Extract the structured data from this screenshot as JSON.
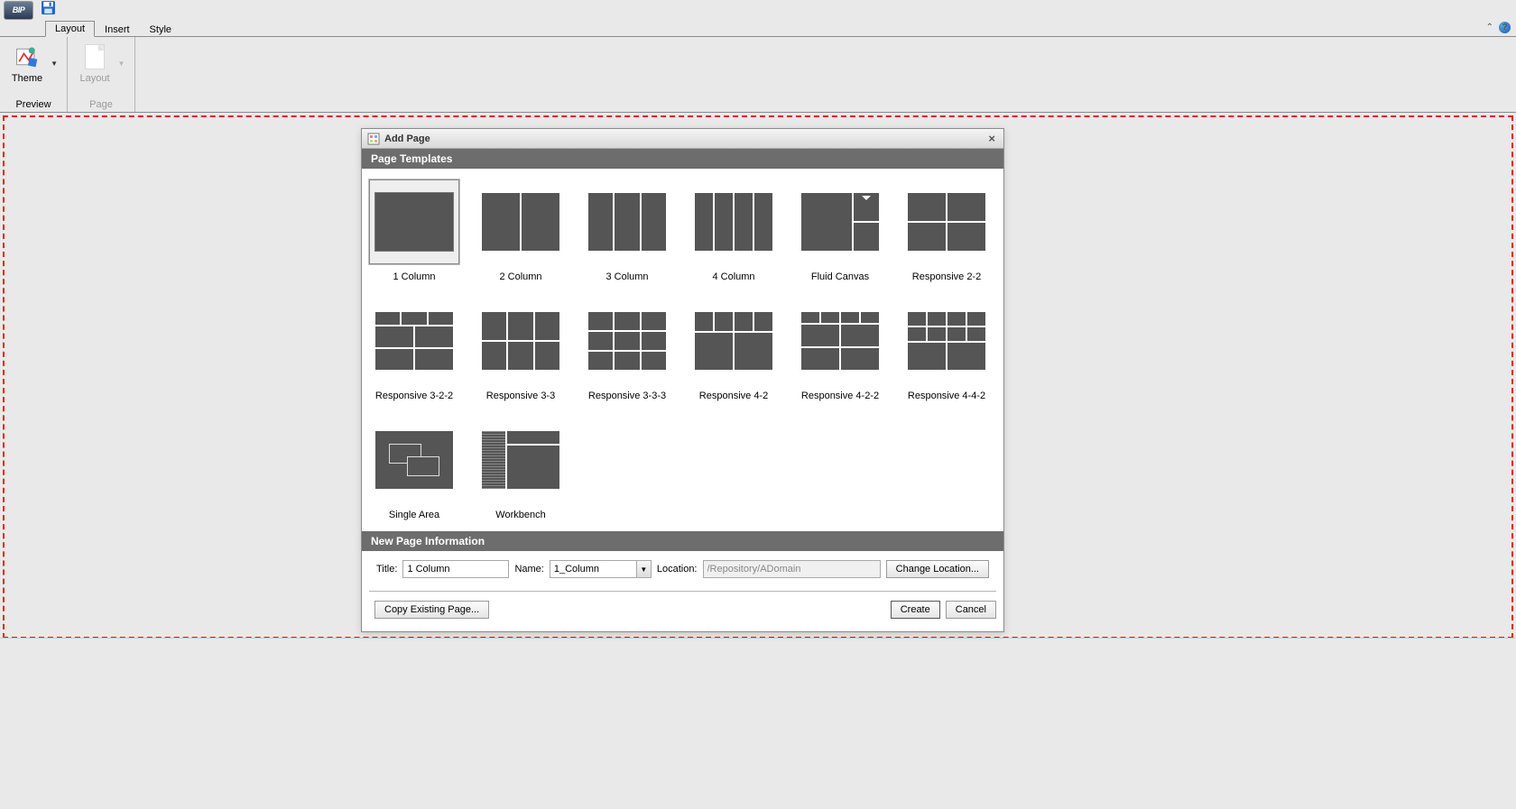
{
  "qat": {
    "app_abbrev": "BIP"
  },
  "tabs": {
    "layout": "Layout",
    "insert": "Insert",
    "style": "Style"
  },
  "ribbon": {
    "theme_label": "Theme",
    "layout_label": "Layout",
    "group_preview": "Preview",
    "group_page": "Page"
  },
  "dialog": {
    "title": "Add Page",
    "section_templates": "Page Templates",
    "section_info": "New Page Information",
    "templates": [
      "1 Column",
      "2 Column",
      "3 Column",
      "4 Column",
      "Fluid Canvas",
      "Responsive 2-2",
      "Responsive 3-2-2",
      "Responsive 3-3",
      "Responsive 3-3-3",
      "Responsive 4-2",
      "Responsive 4-2-2",
      "Responsive 4-4-2",
      "Single Area",
      "Workbench"
    ],
    "title_label": "Title:",
    "title_value": "1 Column",
    "name_label": "Name:",
    "name_value": "1_Column",
    "location_label": "Location:",
    "location_value": "/Repository/ADomain",
    "change_location": "Change Location...",
    "copy_existing": "Copy Existing Page...",
    "create": "Create",
    "cancel": "Cancel"
  }
}
